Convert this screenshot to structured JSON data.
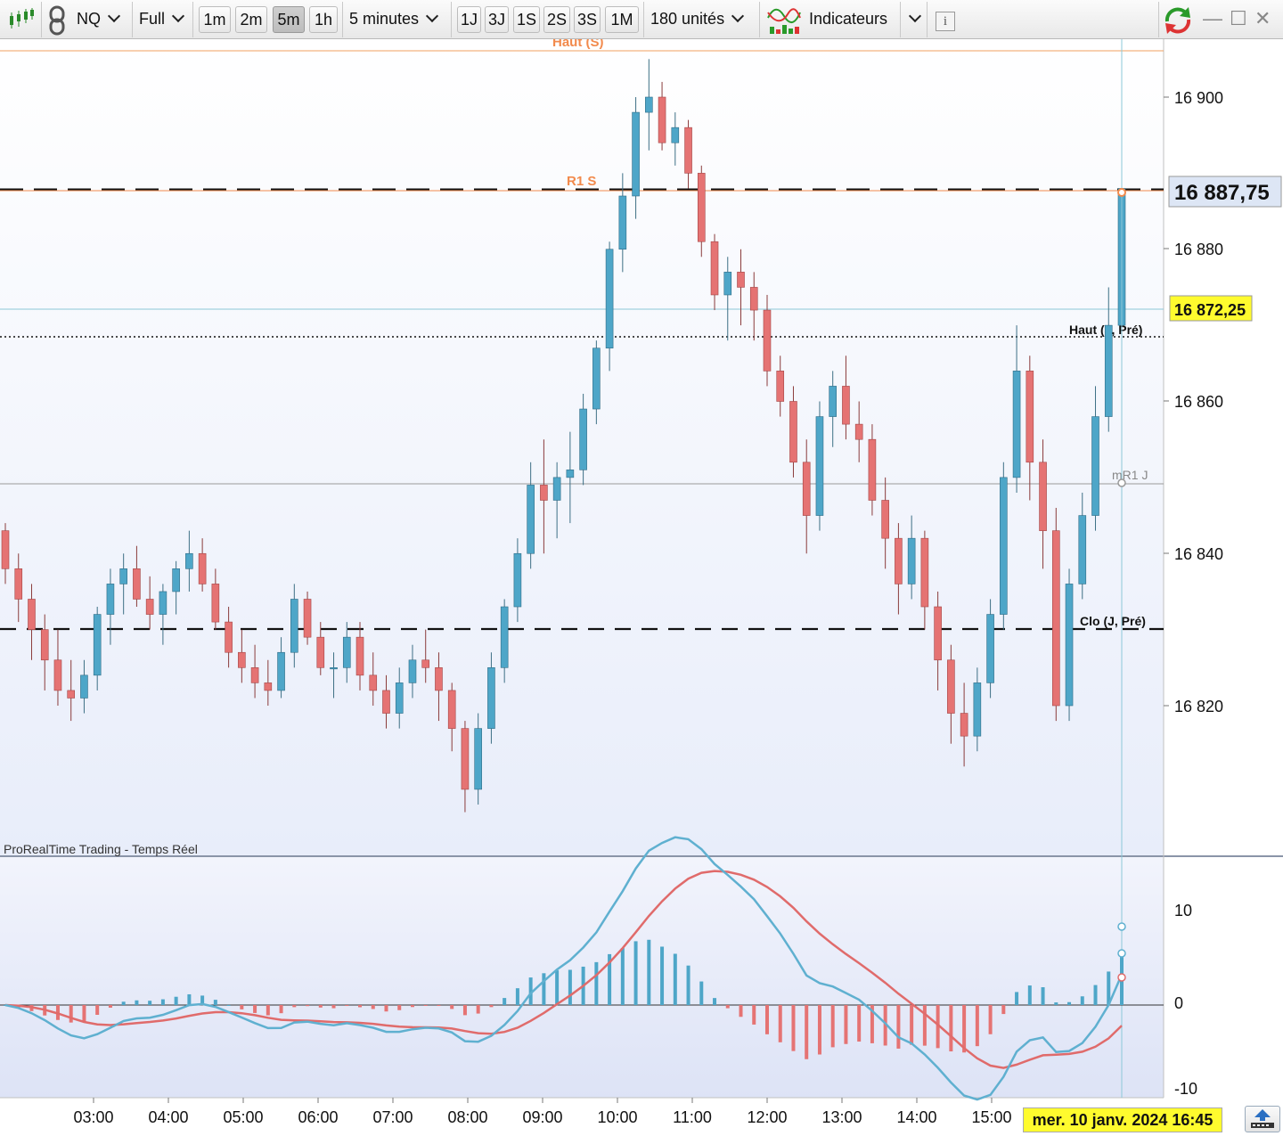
{
  "toolbar": {
    "symbol": "NQ",
    "view": "Full",
    "timeframes": [
      "1m",
      "2m",
      "5m",
      "1h"
    ],
    "active_timeframe": "5m",
    "interval": "5 minutes",
    "ranges": [
      "1J",
      "3J",
      "1S",
      "2S",
      "3S",
      "1M"
    ],
    "units": "180 unités",
    "indicators": "Indicateurs",
    "icons": [
      "candlestick-chart-icon",
      "link-icon",
      "indicator-wave-icon",
      "info-icon",
      "refresh-icon",
      "minimize-icon",
      "maximize-icon",
      "close-icon"
    ]
  },
  "price_panel": {
    "watermark": "ProRealTime Trading - Temps Réel",
    "levels": {
      "haut_s": "Haut (S)",
      "r1_s": "R1 S",
      "haut_j_pre": "Haut (J, Pré)",
      "mr1_j": "mR1 J",
      "clo_j_pre": "Clo (J, Pré)"
    },
    "y_ticks": [
      "16 900",
      "16 880",
      "16 860",
      "16 840",
      "16 820"
    ],
    "last_price": "16 887,75",
    "cursor_price": "16 872,25"
  },
  "oscillator_panel": {
    "y_ticks": [
      "10",
      "0",
      "-10"
    ]
  },
  "x_axis": {
    "ticks": [
      "03:00",
      "04:00",
      "05:00",
      "06:00",
      "07:00",
      "08:00",
      "09:00",
      "10:00",
      "11:00",
      "12:00",
      "13:00",
      "14:00",
      "15:00"
    ],
    "cursor_date": "mer. 10 janv. 2024 16:45"
  },
  "colors": {
    "up": "#4ea6c8",
    "down": "#e57373",
    "macd_line": "#5fb0d0",
    "signal_line": "#e06b6b",
    "highlight": "#fffb2e",
    "r1_line": "#f28a4c"
  },
  "chart_data": {
    "type": "candlestick",
    "timeframe": "5m",
    "y_range": [
      16800,
      16908
    ],
    "candles_ohlc": [
      [
        16843,
        16844,
        16836,
        16838
      ],
      [
        16838,
        16840,
        16831,
        16834
      ],
      [
        16834,
        16836,
        16826,
        16830
      ],
      [
        16830,
        16832,
        16822,
        16826
      ],
      [
        16826,
        16830,
        16820,
        16822
      ],
      [
        16822,
        16826,
        16818,
        16821
      ],
      [
        16821,
        16826,
        16819,
        16824
      ],
      [
        16824,
        16833,
        16822,
        16832
      ],
      [
        16832,
        16838,
        16828,
        16836
      ],
      [
        16836,
        16840,
        16832,
        16838
      ],
      [
        16838,
        16841,
        16833,
        16834
      ],
      [
        16834,
        16837,
        16830,
        16832
      ],
      [
        16832,
        16836,
        16828,
        16835
      ],
      [
        16835,
        16839,
        16832,
        16838
      ],
      [
        16838,
        16843,
        16835,
        16840
      ],
      [
        16840,
        16842,
        16835,
        16836
      ],
      [
        16836,
        16838,
        16830,
        16831
      ],
      [
        16831,
        16833,
        16825,
        16827
      ],
      [
        16827,
        16830,
        16823,
        16825
      ],
      [
        16825,
        16828,
        16821,
        16823
      ],
      [
        16823,
        16826,
        16820,
        16822
      ],
      [
        16822,
        16829,
        16821,
        16827
      ],
      [
        16827,
        16836,
        16825,
        16834
      ],
      [
        16834,
        16835,
        16828,
        16829
      ],
      [
        16829,
        16831,
        16824,
        16825
      ],
      [
        16825,
        16827,
        16821,
        16825
      ],
      [
        16825,
        16831,
        16823,
        16829
      ],
      [
        16829,
        16831,
        16822,
        16824
      ],
      [
        16824,
        16827,
        16820,
        16822
      ],
      [
        16822,
        16824,
        16817,
        16819
      ],
      [
        16819,
        16825,
        16817,
        16823
      ],
      [
        16823,
        16828,
        16821,
        16826
      ],
      [
        16826,
        16830,
        16823,
        16825
      ],
      [
        16825,
        16827,
        16818,
        16822
      ],
      [
        16822,
        16823,
        16814,
        16817
      ],
      [
        16817,
        16818,
        16806,
        16809
      ],
      [
        16809,
        16819,
        16807,
        16817
      ],
      [
        16817,
        16827,
        16815,
        16825
      ],
      [
        16825,
        16834,
        16823,
        16833
      ],
      [
        16833,
        16842,
        16831,
        16840
      ],
      [
        16840,
        16852,
        16838,
        16849
      ],
      [
        16849,
        16855,
        16840,
        16847
      ],
      [
        16847,
        16852,
        16842,
        16850
      ],
      [
        16850,
        16856,
        16844,
        16851
      ],
      [
        16851,
        16861,
        16849,
        16859
      ],
      [
        16859,
        16868,
        16857,
        16867
      ],
      [
        16867,
        16881,
        16864,
        16880
      ],
      [
        16880,
        16890,
        16877,
        16887
      ],
      [
        16887,
        16900,
        16884,
        16898
      ],
      [
        16898,
        16905,
        16893,
        16900
      ],
      [
        16900,
        16902,
        16893,
        16894
      ],
      [
        16894,
        16898,
        16891,
        16896
      ],
      [
        16896,
        16897,
        16888,
        16890
      ],
      [
        16890,
        16891,
        16879,
        16881
      ],
      [
        16881,
        16882,
        16872,
        16874
      ],
      [
        16874,
        16879,
        16868,
        16877
      ],
      [
        16877,
        16880,
        16870,
        16875
      ],
      [
        16875,
        16877,
        16868,
        16872
      ],
      [
        16872,
        16874,
        16862,
        16864
      ],
      [
        16864,
        16866,
        16858,
        16860
      ],
      [
        16860,
        16862,
        16850,
        16852
      ],
      [
        16852,
        16855,
        16840,
        16845
      ],
      [
        16845,
        16860,
        16843,
        16858
      ],
      [
        16858,
        16864,
        16854,
        16862
      ],
      [
        16862,
        16866,
        16855,
        16857
      ],
      [
        16857,
        16860,
        16852,
        16855
      ],
      [
        16855,
        16857,
        16845,
        16847
      ],
      [
        16847,
        16850,
        16838,
        16842
      ],
      [
        16842,
        16844,
        16832,
        16836
      ],
      [
        16836,
        16845,
        16834,
        16842
      ],
      [
        16842,
        16843,
        16830,
        16833
      ],
      [
        16833,
        16835,
        16822,
        16826
      ],
      [
        16826,
        16828,
        16815,
        16819
      ],
      [
        16819,
        16823,
        16812,
        16816
      ],
      [
        16816,
        16825,
        16814,
        16823
      ],
      [
        16823,
        16834,
        16821,
        16832
      ],
      [
        16832,
        16852,
        16830,
        16850
      ],
      [
        16850,
        16870,
        16848,
        16864
      ],
      [
        16864,
        16866,
        16847,
        16852
      ],
      [
        16852,
        16855,
        16838,
        16843
      ],
      [
        16843,
        16846,
        16818,
        16820
      ],
      [
        16820,
        16838,
        16818,
        16836
      ],
      [
        16836,
        16848,
        16834,
        16845
      ],
      [
        16845,
        16862,
        16843,
        16858
      ],
      [
        16858,
        16875,
        16856,
        16870
      ],
      [
        16870,
        16890,
        16868,
        16888
      ]
    ]
  }
}
